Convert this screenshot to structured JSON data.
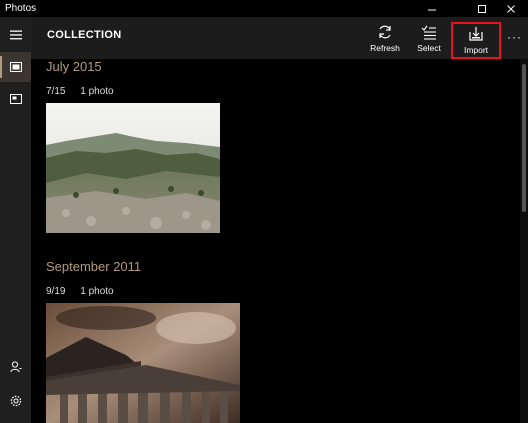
{
  "window": {
    "title": "Photos",
    "controls": [
      "minimize",
      "maximize",
      "close"
    ]
  },
  "rail": {
    "items": [
      {
        "name": "menu",
        "icon": "hamburger-icon"
      },
      {
        "name": "collection",
        "icon": "photo-collection-icon",
        "active": true
      },
      {
        "name": "albums",
        "icon": "album-icon"
      },
      {
        "name": "account",
        "icon": "person-icon"
      },
      {
        "name": "settings",
        "icon": "gear-icon"
      }
    ]
  },
  "header": {
    "title": "COLLECTION",
    "commands": [
      {
        "label": "Refresh",
        "icon": "refresh-icon"
      },
      {
        "label": "Select",
        "icon": "select-list-icon"
      },
      {
        "label": "Import",
        "icon": "import-icon",
        "highlighted": true
      }
    ],
    "more": "···"
  },
  "groups": [
    {
      "title": "July 2015",
      "date": "7/15",
      "count": "1 photo",
      "photo": "landscape-hills"
    },
    {
      "title": "September 2011",
      "date": "9/19",
      "count": "1 photo",
      "photo": "temple-ruins"
    }
  ],
  "colors": {
    "accent": "#b39b7b",
    "highlight": "#e81123",
    "header_bg": "#1c1c1c",
    "rail_bg": "#1f1f1f"
  }
}
